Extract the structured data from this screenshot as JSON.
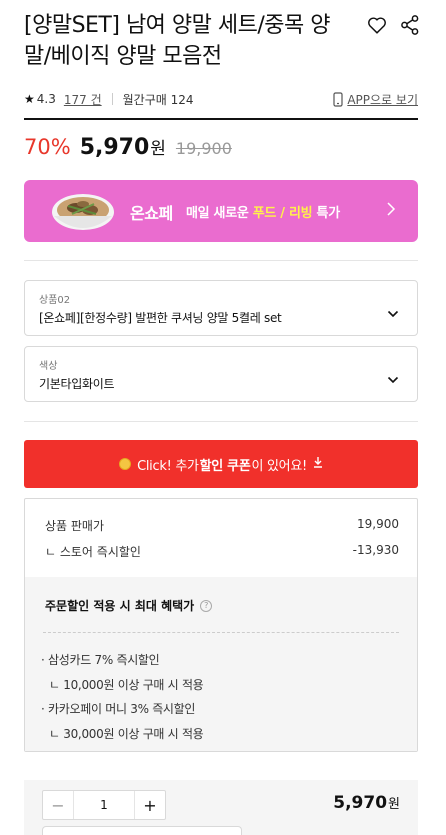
{
  "product": {
    "title": "[양말SET] 남여 양말 세트/중목 양말/베이직 양말 모음전",
    "rating": "4.3",
    "reviews": "177 건",
    "monthly_purchases": "월간구매 124",
    "app_link": "APP으로 보기"
  },
  "price": {
    "discount_rate": "70%",
    "sale_price": "5,970",
    "currency": "원",
    "original_price": "19,900"
  },
  "banner": {
    "brand": "온쇼페",
    "text_pre": "매일 새로운 ",
    "text_hl": "푸드 / 리빙",
    "text_post": " 특가"
  },
  "options": [
    {
      "label": "상품02",
      "value": "[온쇼페][한정수량] 발편한 쿠셔닝 양말 5켤레 set"
    },
    {
      "label": "색상",
      "value": "기본타입화이트"
    }
  ],
  "coupon": {
    "pre": "Click! 추가 ",
    "bold": "할인 쿠폰",
    "post": "이 있어요!"
  },
  "price_detail": {
    "sale_label": "상품 판매가",
    "sale_value": "19,900",
    "store_discount_label": "ㄴ 스토어 즉시할인",
    "store_discount_value": "-13,930",
    "benefit_title": "주문할인 적용 시 최대 혜택가",
    "benefits": [
      {
        "name": "· 삼성카드 7% 즉시할인",
        "condition": "ㄴ 10,000원 이상 구매 시 적용"
      },
      {
        "name": "· 카카오페이 머니 3% 즉시할인",
        "condition": "ㄴ 30,000원 이상 구매 시 적용"
      }
    ]
  },
  "quantity": {
    "minus": "−",
    "value": "1",
    "plus": "+",
    "total": "5,970",
    "currency": "원"
  },
  "colors": {
    "accent_red": "#f1302b",
    "discount_red": "#e8372b",
    "banner_pink": "#ea6ccf",
    "banner_highlight": "#fff249"
  }
}
